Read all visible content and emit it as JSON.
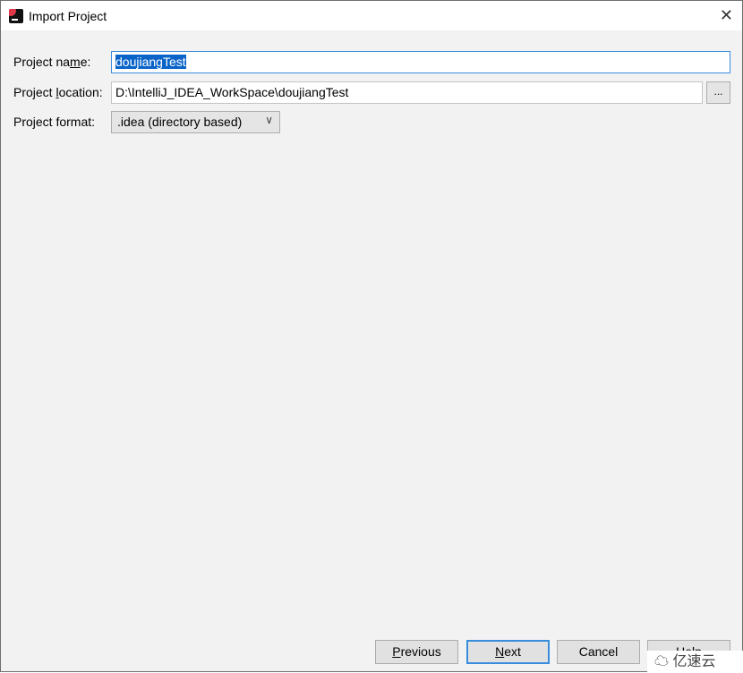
{
  "window": {
    "title": "Import Project",
    "close_icon": "close-icon",
    "app_icon": "intellij-idea-icon"
  },
  "form": {
    "name_label": "Project name:",
    "name_value": "doujiangTest",
    "location_label": "Project location:",
    "location_value": "D:\\IntelliJ_IDEA_WorkSpace\\doujiangTest",
    "browse_label": "...",
    "format_label": "Project format:",
    "format_value": ".idea (directory based)"
  },
  "buttons": {
    "previous": "Previous",
    "next": "Next",
    "cancel": "Cancel",
    "help": "Help"
  },
  "watermark": "亿速云",
  "colors": {
    "accent": "#3a8ddc",
    "selection": "#0a64c8"
  }
}
